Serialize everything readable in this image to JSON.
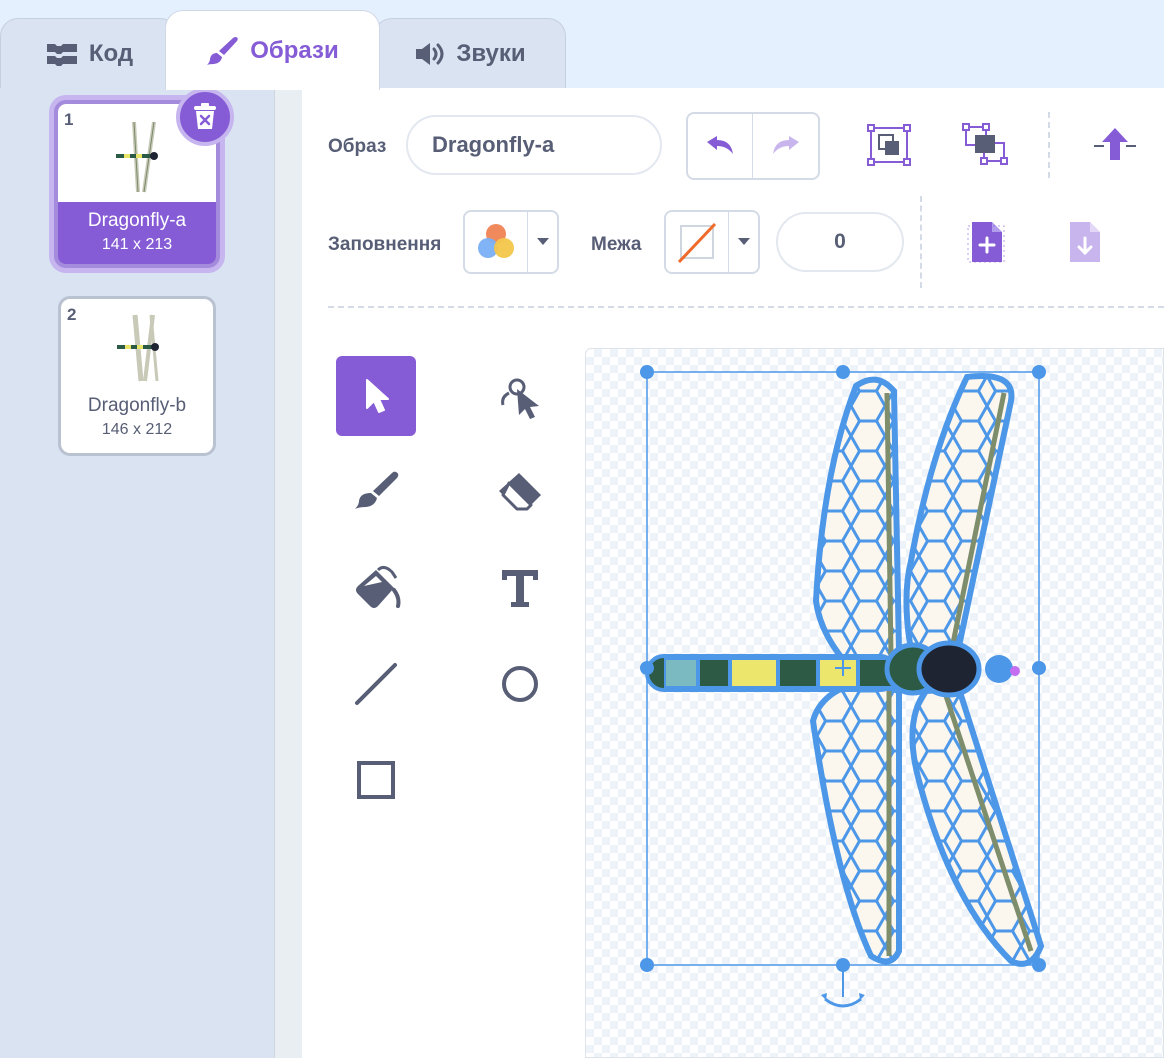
{
  "tabs": [
    {
      "label": "Код",
      "icon": "code-blocks-icon"
    },
    {
      "label": "Образи",
      "icon": "paintbrush-icon"
    },
    {
      "label": "Звуки",
      "icon": "speaker-icon"
    }
  ],
  "active_tab": "Образи",
  "costumes": [
    {
      "number": "1",
      "name": "Dragonfly-a",
      "size": "141 x 213",
      "selected": true
    },
    {
      "number": "2",
      "name": "Dragonfly-b",
      "size": "146 x 212",
      "selected": false
    }
  ],
  "editor": {
    "costume_label": "Образ",
    "costume_name": "Dragonfly-a",
    "fill_label": "Заповнення",
    "outline_label": "Межа",
    "outline_width": "0"
  },
  "tools": [
    "select-tool",
    "reshape-tool",
    "brush-tool",
    "eraser-tool",
    "fill-tool",
    "text-tool",
    "line-tool",
    "circle-tool",
    "rectangle-tool"
  ],
  "active_tool": "select-tool",
  "colors": {
    "accent": "#855cd6",
    "selection": "#4c97ff",
    "text": "#575e75"
  }
}
